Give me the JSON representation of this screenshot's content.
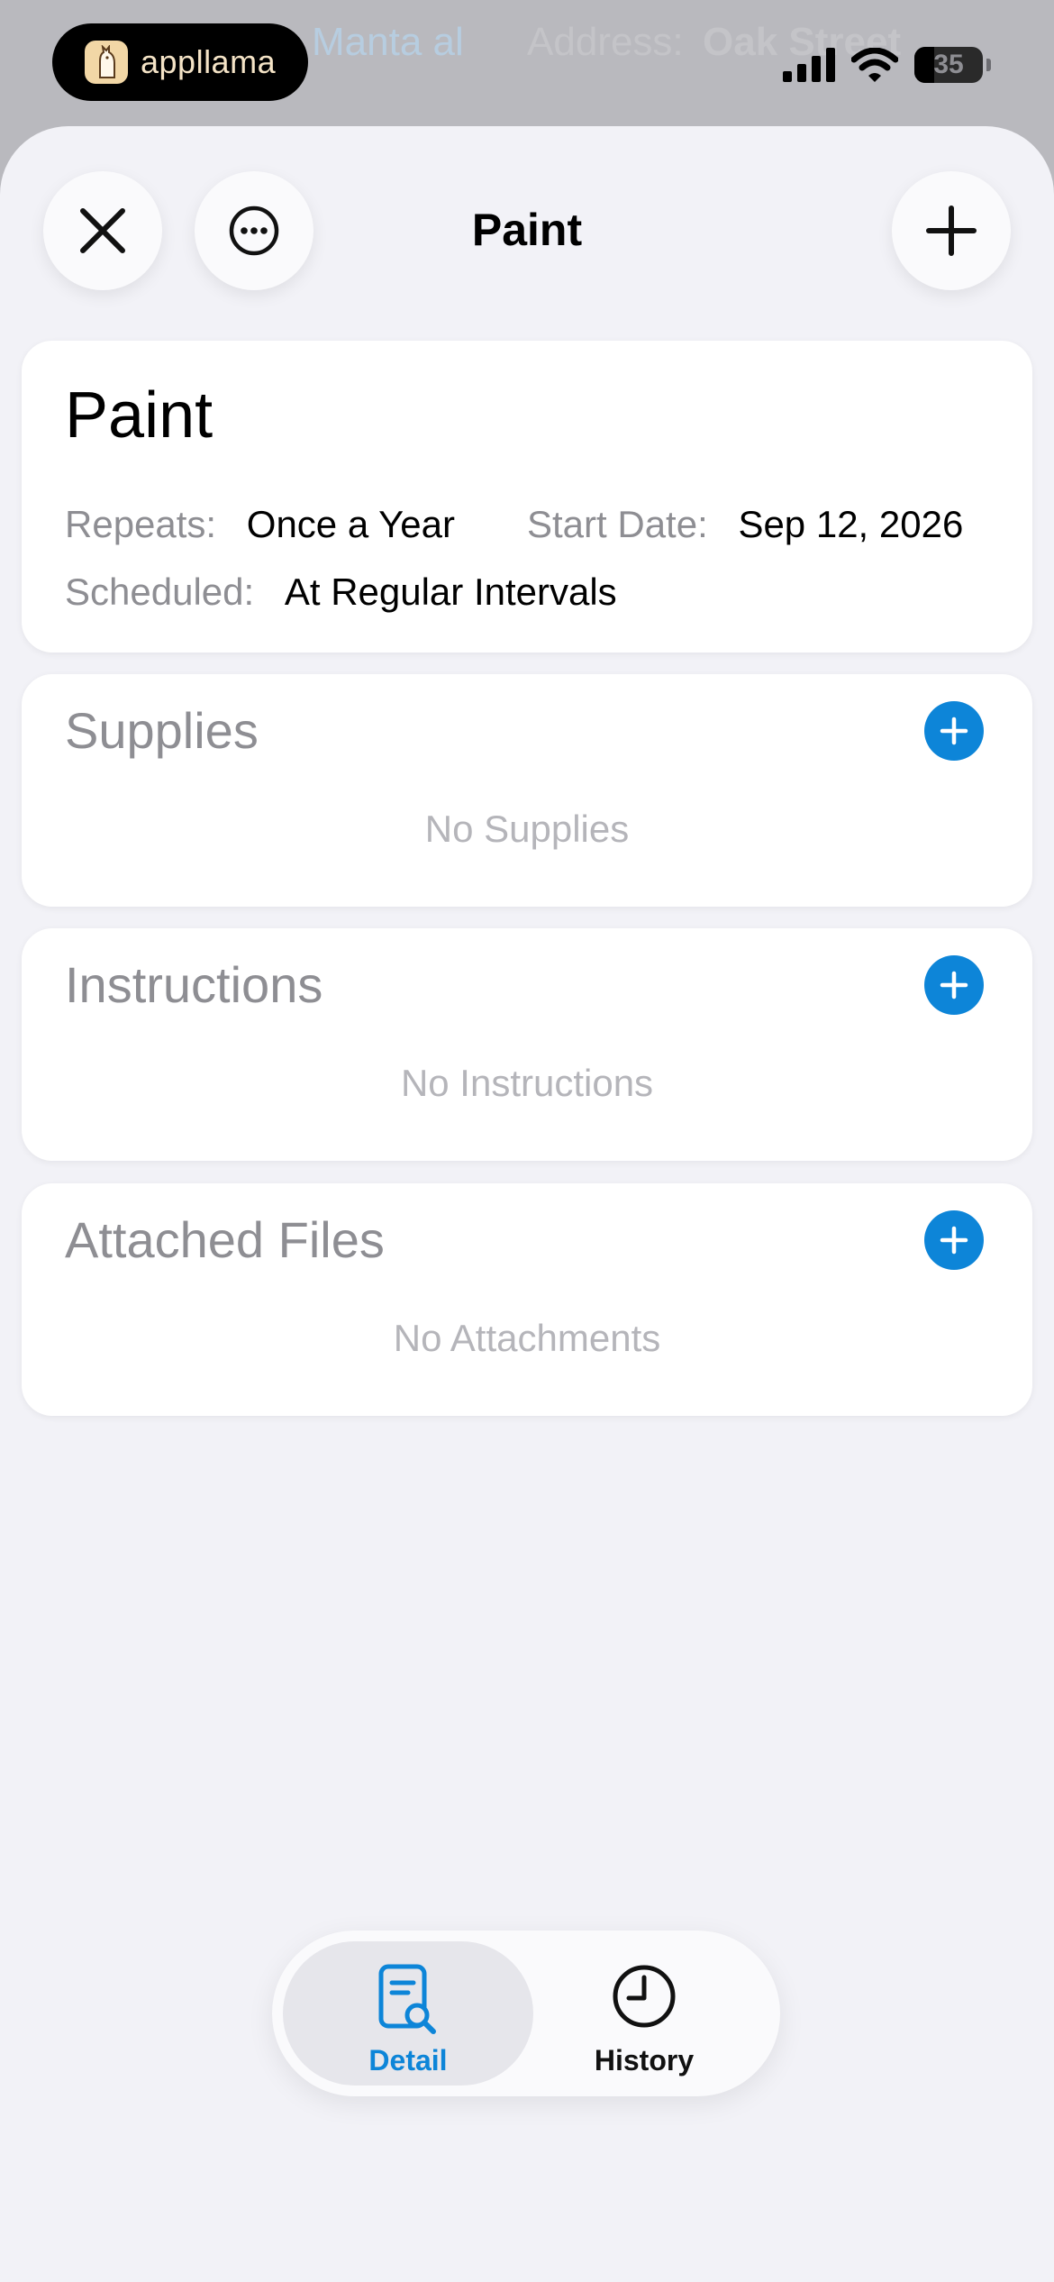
{
  "status_bar": {
    "app_badge": "appllama",
    "battery_level": "35",
    "background_text": [
      "Manta al",
      "Address:",
      "Oak Street"
    ]
  },
  "nav": {
    "title": "Paint",
    "close_icon": "close-icon",
    "more_icon": "ellipsis-circle-icon",
    "add_icon": "plus-icon"
  },
  "task": {
    "title": "Paint",
    "repeats_label": "Repeats:",
    "repeats_value": "Once a Year",
    "start_date_label": "Start Date:",
    "start_date_value": "Sep 12, 2026",
    "scheduled_label": "Scheduled:",
    "scheduled_value": "At Regular Intervals"
  },
  "sections": [
    {
      "title": "Supplies",
      "empty_text": "No Supplies"
    },
    {
      "title": "Instructions",
      "empty_text": "No Instructions"
    },
    {
      "title": "Attached Files",
      "empty_text": "No Attachments"
    }
  ],
  "tabbar": {
    "tabs": [
      {
        "label": "Detail",
        "icon": "document-search-icon",
        "active": true
      },
      {
        "label": "History",
        "icon": "clock-icon",
        "active": false
      }
    ]
  },
  "colors": {
    "accent": "#0d85d8",
    "sheet_background": "#f2f2f7",
    "secondary_text": "#8e8e93",
    "placeholder_text": "#b5b5ba"
  }
}
